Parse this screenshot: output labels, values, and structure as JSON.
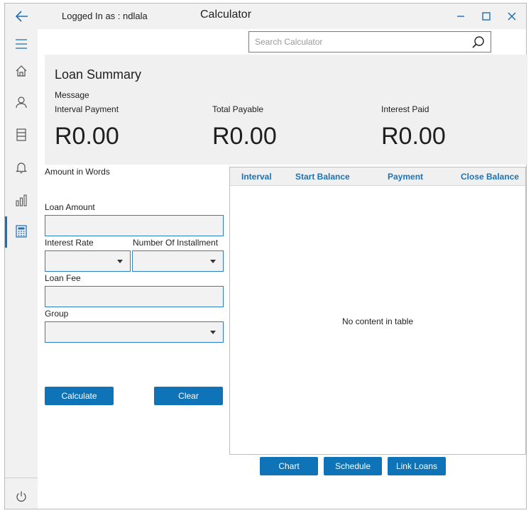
{
  "titlebar": {
    "logged_in": "Logged In as : ndlala",
    "app_title": "Calculator"
  },
  "search": {
    "placeholder": "Search Calculator"
  },
  "summary": {
    "title": "Loan Summary",
    "message_label": "Message",
    "interval_payment_label": "Interval Payment",
    "total_payable_label": "Total Payable",
    "interest_paid_label": "Interest Paid",
    "interval_payment_value": "R0.00",
    "total_payable_value": "R0.00",
    "interest_paid_value": "R0.00"
  },
  "form": {
    "amount_in_words_label": "Amount in Words",
    "loan_amount_label": "Loan Amount",
    "interest_rate_label": "Interest Rate",
    "installments_label": "Number Of Installment",
    "loan_fee_label": "Loan Fee",
    "group_label": "Group",
    "calculate_label": "Calculate",
    "clear_label": "Clear"
  },
  "table": {
    "columns": [
      "Interval",
      "Start Balance",
      "Payment",
      "Close Balance"
    ],
    "empty_text": "No content in table"
  },
  "bottom_buttons": {
    "chart": "Chart",
    "schedule": "Schedule",
    "link_loans": "Link Loans"
  },
  "colors": {
    "accent": "#0f73b8",
    "header_text": "#1a73b8",
    "panel_bg": "#f0f0f0"
  },
  "icons": {
    "sidebar": [
      "hamburger-icon",
      "home-icon",
      "person-icon",
      "list-icon",
      "bell-icon",
      "chart-icon",
      "calculator-icon",
      "power-icon"
    ]
  }
}
